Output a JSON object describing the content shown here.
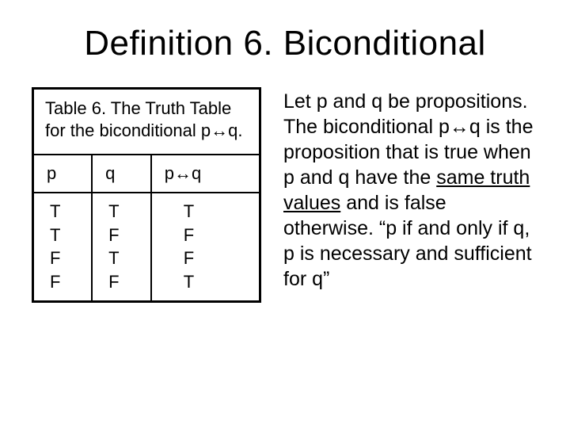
{
  "title": "Definition 6.  Biconditional",
  "arrow": "↔",
  "caption": {
    "pre": "Table 6. The Truth Table for the biconditional p",
    "post": "q."
  },
  "headers": {
    "p": "p",
    "q": "q",
    "pq_pre": "p",
    "pq_post": "q"
  },
  "rows": {
    "p": [
      "T",
      "T",
      "F",
      "F"
    ],
    "q": [
      "T",
      "F",
      "T",
      "F"
    ],
    "pq": [
      "T",
      "F",
      "F",
      "T"
    ]
  },
  "body": {
    "t1": "Let p and q be propositions.  The biconditional p",
    "t2": "q is the proposition that is true when p and q have the ",
    "underlined": "same truth values",
    "t3": " and is false otherwise. “p if and only if q, p is necessary and sufficient for q”"
  }
}
